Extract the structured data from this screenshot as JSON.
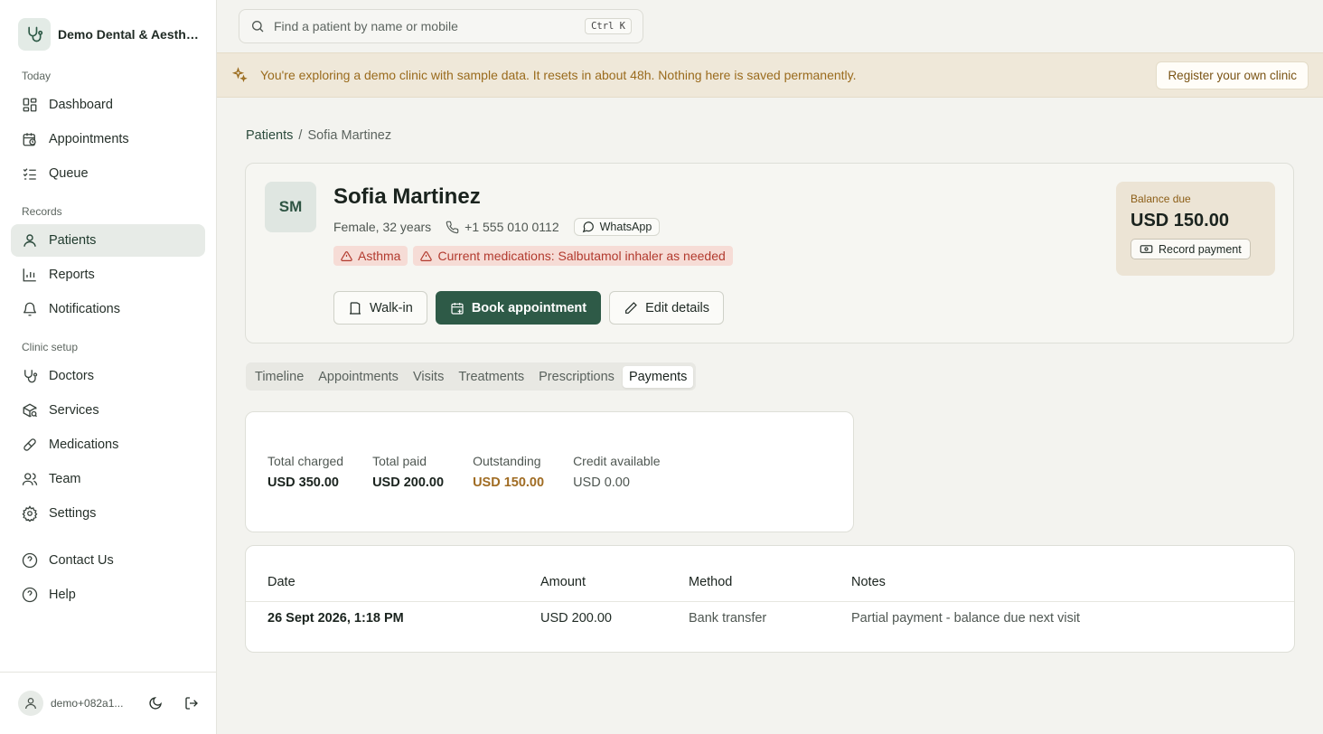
{
  "sidebar": {
    "clinic_name": "Demo Dental & Aesthe...",
    "sections": {
      "today": "Today",
      "records": "Records",
      "setup": "Clinic setup"
    },
    "items": {
      "dashboard": "Dashboard",
      "appointments": "Appointments",
      "queue": "Queue",
      "patients": "Patients",
      "reports": "Reports",
      "notifications": "Notifications",
      "doctors": "Doctors",
      "services": "Services",
      "medications": "Medications",
      "team": "Team",
      "settings": "Settings",
      "contact": "Contact Us",
      "help": "Help"
    },
    "user_email": "demo+082a1..."
  },
  "search": {
    "placeholder": "Find a patient by name or mobile",
    "shortcut": "Ctrl K"
  },
  "banner": {
    "text": "You're exploring a demo clinic with sample data. It resets in about 48h. Nothing here is saved permanently.",
    "button": "Register your own clinic"
  },
  "breadcrumb": {
    "parent": "Patients",
    "separator": "/",
    "current": "Sofia Martinez"
  },
  "patient": {
    "initials": "SM",
    "name": "Sofia Martinez",
    "meta": "Female, 32 years",
    "phone": "+1 555 010 0112",
    "whatsapp": "WhatsApp",
    "tags": [
      "Asthma",
      "Current medications: Salbutamol inhaler as needed"
    ],
    "actions": {
      "walkin": "Walk-in",
      "book": "Book appointment",
      "edit": "Edit details"
    },
    "balance": {
      "label": "Balance due",
      "amount": "USD 150.00",
      "button": "Record payment"
    }
  },
  "tabs": [
    "Timeline",
    "Appointments",
    "Visits",
    "Treatments",
    "Prescriptions",
    "Payments"
  ],
  "active_tab": "Payments",
  "summary": [
    {
      "label": "Total charged",
      "value": "USD 350.00"
    },
    {
      "label": "Total paid",
      "value": "USD 200.00"
    },
    {
      "label": "Outstanding",
      "value": "USD 150.00"
    },
    {
      "label": "Credit available",
      "value": "USD 0.00"
    }
  ],
  "payments_table": {
    "columns": [
      "Date",
      "Amount",
      "Method",
      "Notes"
    ],
    "rows": [
      [
        "26 Sept 2026, 1:18 PM",
        "USD 200.00",
        "Bank transfer",
        "Partial payment - balance due next visit"
      ]
    ]
  },
  "colors": {
    "accent": "#2e5a47",
    "warning_text": "#9a6b1d",
    "danger_text": "#b23a2e",
    "banner_bg": "#efe8d9"
  }
}
